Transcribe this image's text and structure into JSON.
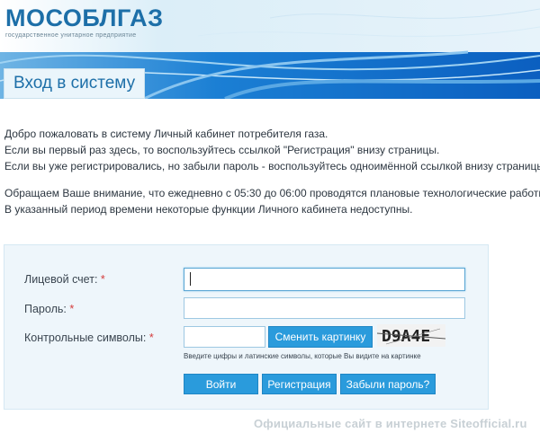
{
  "header": {
    "logo_text": "МОСОБЛГАЗ",
    "logo_subtitle": "государственное унитарное предприятие",
    "page_title": "Вход в систему"
  },
  "intro": {
    "line1": "Добро пожаловать в систему Личный кабинет потребителя газа.",
    "line2": "Если вы первый раз здесь, то воспользуйтесь ссылкой \"Регистрация\" внизу страницы.",
    "line3": "Если вы уже регистрировались, но забыли пароль - воспользуйтесь одноимённой ссылкой внизу страницы.",
    "line4": "Обращаем Ваше внимание, что ежедневно с 05:30 до 06:00 проводятся плановые технологические работы.",
    "line5": "В указанный период времени некоторые функции Личного кабинета недоступны."
  },
  "form": {
    "account_label": "Лицевой счет:",
    "password_label": "Пароль:",
    "captcha_label": "Контрольные символы:",
    "required_mark": "*",
    "account_value": "",
    "password_value": "",
    "captcha_value": "",
    "change_image_label": "Сменить картинку",
    "captcha_text": "D9A4E",
    "hint": "Введите цифры и латинские символы, которые Вы видите на картинке",
    "login_label": "Войти",
    "register_label": "Регистрация",
    "forgot_label": "Забыли пароль?"
  },
  "watermark": "Официальные сайт в интернете Siteofficial.ru",
  "colors": {
    "brand_blue": "#1d6fa8",
    "button_blue": "#2a9bdc",
    "panel_bg": "#eef6fb",
    "required_red": "#d43b3b"
  }
}
